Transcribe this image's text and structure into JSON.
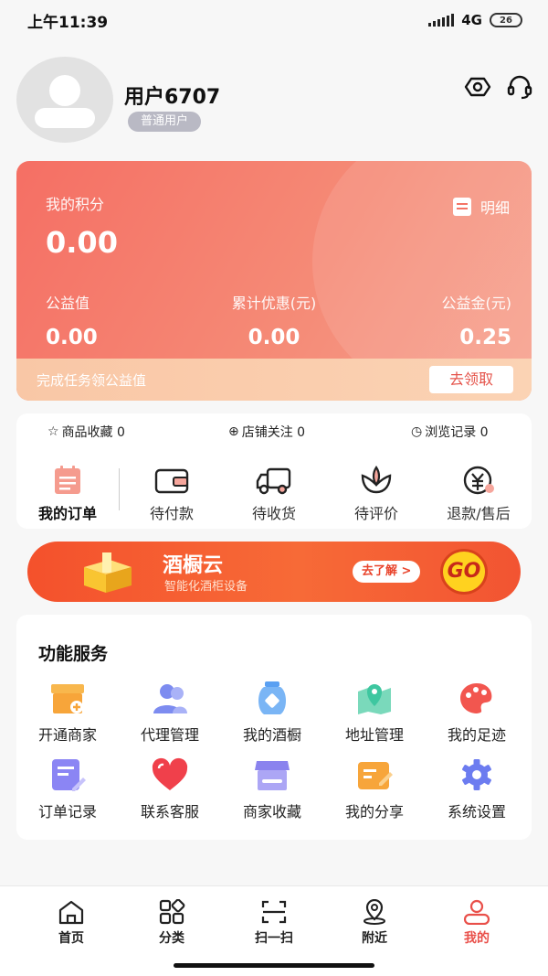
{
  "status_bar": {
    "time": "上午11:39",
    "network": "4G",
    "battery": "26"
  },
  "profile": {
    "username": "用户6707",
    "badge": "普通用户",
    "settings_icon": "settings-icon",
    "service_icon": "headset-icon"
  },
  "points_card": {
    "label": "我的积分",
    "points": "0.00",
    "detail_label": "明细",
    "stats": [
      {
        "label": "公益值",
        "value": "0.00"
      },
      {
        "label": "累计优惠(元)",
        "value": "0.00"
      },
      {
        "label": "公益金(元)",
        "value": "0.25"
      }
    ],
    "task_text": "完成任务领公益值",
    "claim_label": "去领取"
  },
  "favorites": [
    {
      "label": "商品收藏 0",
      "icon": "star-icon",
      "glyph": "☆"
    },
    {
      "label": "店铺关注 0",
      "icon": "plus-circle-icon",
      "glyph": "⊕"
    },
    {
      "label": "浏览记录 0",
      "icon": "clock-icon",
      "glyph": "◷"
    }
  ],
  "orders": {
    "my_orders": "我的订单",
    "items": [
      {
        "label": "待付款",
        "icon": "wallet-icon"
      },
      {
        "label": "待收货",
        "icon": "truck-icon"
      },
      {
        "label": "待评价",
        "icon": "flower-icon"
      },
      {
        "label": "退款/售后",
        "icon": "refund-icon"
      }
    ]
  },
  "banner": {
    "title": "酒橱云",
    "subtitle": "智能化酒柜设备",
    "cta": "去了解 >",
    "go": "GO"
  },
  "services": {
    "title": "功能服务",
    "items": [
      {
        "label": "开通商家",
        "icon": "store-open-icon",
        "color": "#f7a53a"
      },
      {
        "label": "代理管理",
        "icon": "agent-icon",
        "color": "#7d8cf0"
      },
      {
        "label": "我的酒橱",
        "icon": "wine-jar-icon",
        "color": "#5aa0f2"
      },
      {
        "label": "地址管理",
        "icon": "map-pin-icon",
        "color": "#3ec7a0"
      },
      {
        "label": "我的足迹",
        "icon": "palette-icon",
        "color": "#f2564f"
      },
      {
        "label": "订单记录",
        "icon": "order-record-icon",
        "color": "#8b85f4"
      },
      {
        "label": "联系客服",
        "icon": "heart-icon",
        "color": "#f0404b"
      },
      {
        "label": "商家收藏",
        "icon": "shop-icon",
        "color": "#8a83ee"
      },
      {
        "label": "我的分享",
        "icon": "share-icon",
        "color": "#f7a53a"
      },
      {
        "label": "系统设置",
        "icon": "gear-icon",
        "color": "#6c7cf0"
      }
    ]
  },
  "tabbar": {
    "items": [
      {
        "label": "首页",
        "icon": "home-icon"
      },
      {
        "label": "分类",
        "icon": "category-icon"
      },
      {
        "label": "扫一扫",
        "icon": "scan-icon"
      },
      {
        "label": "附近",
        "icon": "location-icon"
      },
      {
        "label": "我的",
        "icon": "user-icon",
        "active": true
      }
    ]
  },
  "colors": {
    "accent": "#e9504a",
    "card_gradient_start": "#f56f64",
    "banner": "#f4512c"
  }
}
